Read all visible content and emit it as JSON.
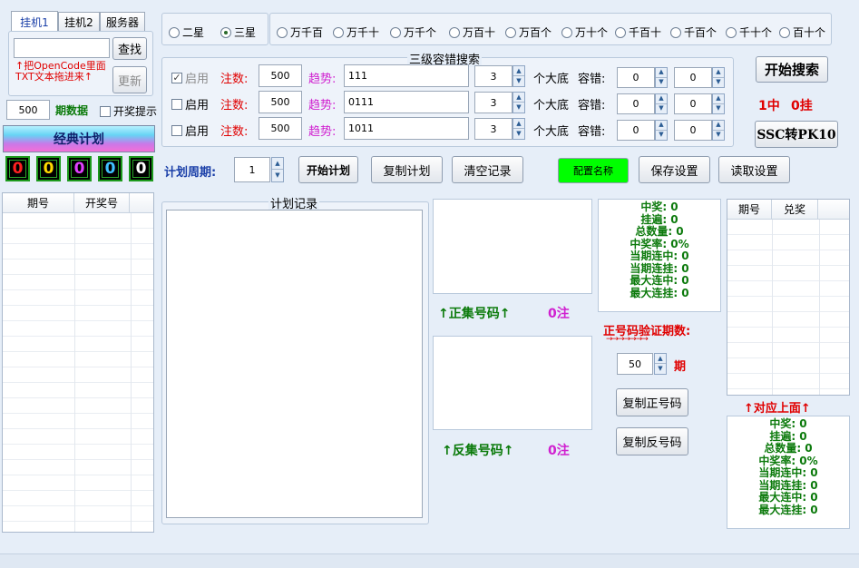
{
  "tabs": [
    "挂机1",
    "挂机2",
    "服务器"
  ],
  "left": {
    "find_btn": "查找",
    "update_btn": "更新",
    "hint": "↑把OpenCode里面TXT文本拖进来↑",
    "period_value": "500",
    "period_label": "期数据",
    "open_prompt": "开奖提示",
    "classic_plan": "经典计划",
    "digits": [
      "0",
      "0",
      "0",
      "0",
      "0"
    ],
    "digit_colors": [
      "#ff2020",
      "#ffd800",
      "#e040ff",
      "#40c0ff",
      "#ffffff"
    ],
    "grid_headers": [
      "期号",
      "开奖号"
    ]
  },
  "star_radios": [
    {
      "label": "二星",
      "selected": false
    },
    {
      "label": "三星",
      "selected": true
    }
  ],
  "position_radios": [
    "万千百",
    "万千十",
    "万千个",
    "万百十",
    "万百个",
    "万十个",
    "千百十",
    "千百个",
    "千十个",
    "百十个"
  ],
  "search": {
    "title": "三级容错搜索",
    "rows": [
      {
        "enable": "启用",
        "checked": true,
        "disabled": true,
        "bets_label": "注数:",
        "bets": "500",
        "trend_label": "趋势:",
        "trend": "111",
        "spin": "3",
        "base_label": "个大底",
        "tol_label": "容错:",
        "tol1": "0",
        "tol2": "0"
      },
      {
        "enable": "启用",
        "checked": false,
        "disabled": false,
        "bets_label": "注数:",
        "bets": "500",
        "trend_label": "趋势:",
        "trend": "0111",
        "spin": "3",
        "base_label": "个大底",
        "tol_label": "容错:",
        "tol1": "0",
        "tol2": "0"
      },
      {
        "enable": "启用",
        "checked": false,
        "disabled": false,
        "bets_label": "注数:",
        "bets": "500",
        "trend_label": "趋势:",
        "trend": "1011",
        "spin": "3",
        "base_label": "个大底",
        "tol_label": "容错:",
        "tol1": "0",
        "tol2": "0"
      }
    ]
  },
  "right_top": {
    "start_search": "开始搜索",
    "hits": "1中",
    "misses": "0挂",
    "ssc_btn": "SSC转PK10"
  },
  "plan": {
    "cycle_label": "计划周期:",
    "cycle_value": "1",
    "start_plan": "开始计划",
    "copy_plan": "复制计划",
    "clear_record": "清空记录",
    "config_name": "配置名称",
    "config_color": "#00ff00",
    "save_settings": "保存设置",
    "read_settings": "读取设置",
    "record_title": "计划记录"
  },
  "center": {
    "positive_label": "↑正集号码↑",
    "positive_count": "0注",
    "negative_label": "↑反集号码↑",
    "negative_count": "0注"
  },
  "stats_top": [
    "中奖: 0",
    "挂遍: 0",
    "总数量: 0",
    "中奖率: 0%",
    "当期连中: 0",
    "当期连挂: 0",
    "最大连中: 0",
    "最大连挂: 0"
  ],
  "verify": {
    "title": "正号码验证期数:",
    "arrows": "→→→→→→→",
    "value": "50",
    "unit": "期",
    "copy_positive": "复制正号码",
    "copy_negative": "复制反号码"
  },
  "right_grid": {
    "headers": [
      "期号",
      "兑奖"
    ],
    "corresponding": "↑对应上面↑"
  },
  "stats_bottom": [
    "中奖: 0",
    "挂遍: 0",
    "总数量: 0",
    "中奖率: 0%",
    "当期连中: 0",
    "当期连挂: 0",
    "最大连中: 0",
    "最大连挂: 0"
  ]
}
